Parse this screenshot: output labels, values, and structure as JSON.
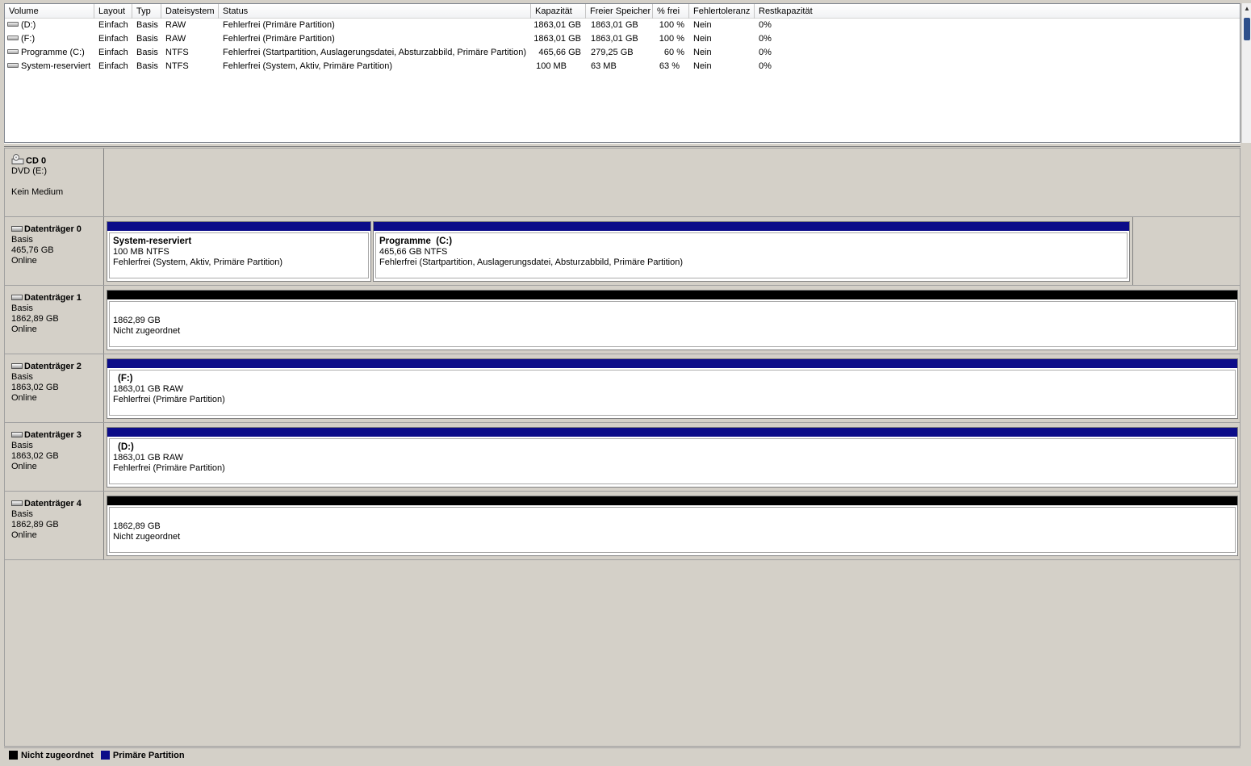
{
  "volume_list": {
    "columns": [
      "Volume",
      "Layout",
      "Typ",
      "Dateisystem",
      "Status",
      "Kapazität",
      "Freier Speicher",
      "% frei",
      "Fehlertoleranz",
      "Restkapazität"
    ],
    "rows": [
      [
        "(D:)",
        "Einfach",
        "Basis",
        "RAW",
        "Fehlerfrei (Primäre Partition)",
        "1863,01 GB",
        "1863,01 GB",
        "100 %",
        "Nein",
        "0%"
      ],
      [
        "(F:)",
        "Einfach",
        "Basis",
        "RAW",
        "Fehlerfrei (Primäre Partition)",
        "1863,01 GB",
        "1863,01 GB",
        "100 %",
        "Nein",
        "0%"
      ],
      [
        "Programme (C:)",
        "Einfach",
        "Basis",
        "NTFS",
        "Fehlerfrei (Startpartition, Auslagerungsdatei, Absturzabbild, Primäre Partition)",
        "465,66 GB",
        "279,25 GB",
        "60 %",
        "Nein",
        "0%"
      ],
      [
        "System-reserviert",
        "Einfach",
        "Basis",
        "NTFS",
        "Fehlerfrei (System, Aktiv, Primäre Partition)",
        "100 MB",
        "63 MB",
        "63 %",
        "Nein",
        "0%"
      ]
    ]
  },
  "disks": [
    {
      "name": "CD 0",
      "line1": "DVD (E:)",
      "line2": "",
      "line3": "Kein Medium"
    },
    {
      "name": "Datenträger 0",
      "line1": "Basis",
      "line2": "465,76 GB",
      "line3": "Online",
      "partitions": [
        {
          "title": "System-reserviert",
          "size": "100 MB NTFS",
          "status": "Fehlerfrei (System, Aktiv, Primäre Partition)"
        },
        {
          "title": "Programme  (C:)",
          "size": "465,66 GB NTFS",
          "status": "Fehlerfrei (Startpartition, Auslagerungsdatei, Absturzabbild, Primäre Partition)"
        }
      ]
    },
    {
      "name": "Datenträger 1",
      "line1": "Basis",
      "line2": "1862,89 GB",
      "line3": "Online",
      "partitions": [
        {
          "title": "",
          "size": "1862,89 GB",
          "status": "Nicht zugeordnet"
        }
      ]
    },
    {
      "name": "Datenträger 2",
      "line1": "Basis",
      "line2": "1863,02 GB",
      "line3": "Online",
      "partitions": [
        {
          "title": "(F:)",
          "size": "1863,01 GB RAW",
          "status": "Fehlerfrei (Primäre Partition)"
        }
      ]
    },
    {
      "name": "Datenträger 3",
      "line1": "Basis",
      "line2": "1863,02 GB",
      "line3": "Online",
      "partitions": [
        {
          "title": "(D:)",
          "size": "1863,01 GB RAW",
          "status": "Fehlerfrei (Primäre Partition)"
        }
      ]
    },
    {
      "name": "Datenträger 4",
      "line1": "Basis",
      "line2": "1862,89 GB",
      "line3": "Online",
      "partitions": [
        {
          "title": "",
          "size": "1862,89 GB",
          "status": "Nicht zugeordnet"
        }
      ]
    }
  ],
  "legend": {
    "unallocated": "Nicht zugeordnet",
    "primary": "Primäre Partition"
  },
  "colors": {
    "primary_partition": "#0c0c89",
    "unallocated": "#000000",
    "background": "#d4d0c8"
  }
}
